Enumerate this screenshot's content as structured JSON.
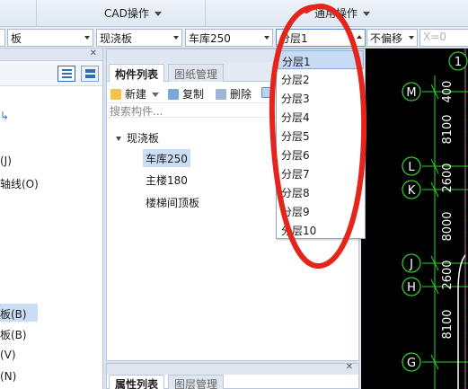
{
  "ribbon": {
    "group_cad": "CAD操作",
    "group_general": "通用操作"
  },
  "selector": {
    "floor_partial": "板",
    "category": "现浇板",
    "component": "车库250",
    "layer": "分层1",
    "offset": "不偏移",
    "x_label": "X=",
    "x_value": "0"
  },
  "left_panel": {
    "items": [
      "(J)",
      "轴线(O)",
      "板(B)",
      "板(B)",
      "(V)",
      "(N)"
    ]
  },
  "mid_panel": {
    "tabs": [
      "构件列表",
      "图纸管理"
    ],
    "toolbar": [
      "新建",
      "复制",
      "删除"
    ],
    "search_placeholder": "搜索构件...",
    "tree_root": "现浇板",
    "tree_children": [
      "车库250",
      "主楼180",
      "楼梯间顶板"
    ]
  },
  "bottom_panel": {
    "tabs": [
      "属性列表",
      "图层管理"
    ]
  },
  "dropdown": {
    "header": "分层1",
    "items": [
      "分层1",
      "分层2",
      "分层3",
      "分层4",
      "分层5",
      "分层6",
      "分层7",
      "分层8",
      "分层9",
      "分层10"
    ]
  },
  "cad": {
    "axis_marks": [
      "1",
      "M",
      "L",
      "K",
      "J",
      "H",
      "G"
    ],
    "dims": [
      "400",
      "8100",
      "2600",
      "8000",
      "2600",
      "8100"
    ]
  },
  "colors": {
    "annotation": "#e5241b",
    "cad_background": "#000000",
    "cad_line": "#2fd32f",
    "cad_text": "#ffffff",
    "selection": "#c7dcf4"
  }
}
